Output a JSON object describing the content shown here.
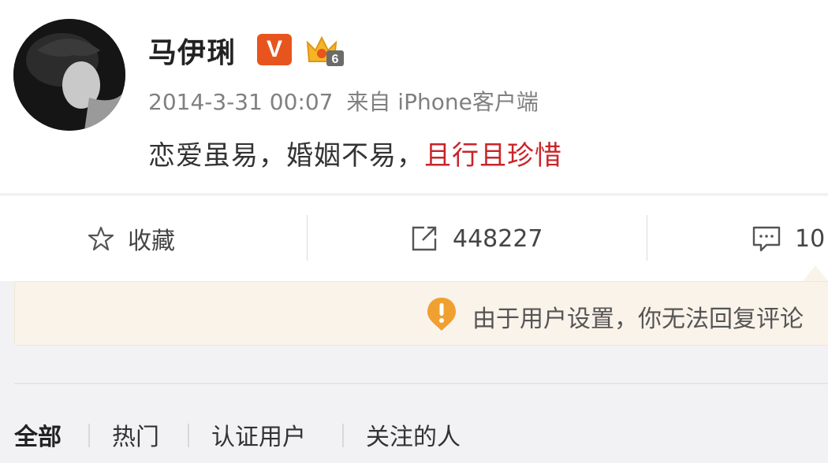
{
  "post": {
    "username": "马伊琍",
    "verified_badge": "V",
    "member_level": "6",
    "timestamp": "2014-3-31 00:07",
    "source": "来自 iPhone客户端",
    "content_plain": "恋爱虽易，婚姻不易，",
    "content_highlight": "且行且珍惜"
  },
  "actions": {
    "favorite_label": "收藏",
    "repost_count": "448227",
    "comment_count": "10"
  },
  "notice": {
    "text": "由于用户设置，你无法回复评论"
  },
  "comment_tabs": [
    "全部",
    "热门",
    "认证用户",
    "关注的人"
  ],
  "colors": {
    "highlight": "#c9242a",
    "badge": "#e8541e",
    "notice_bg": "#faf3ea",
    "notice_icon": "#f0a030"
  }
}
